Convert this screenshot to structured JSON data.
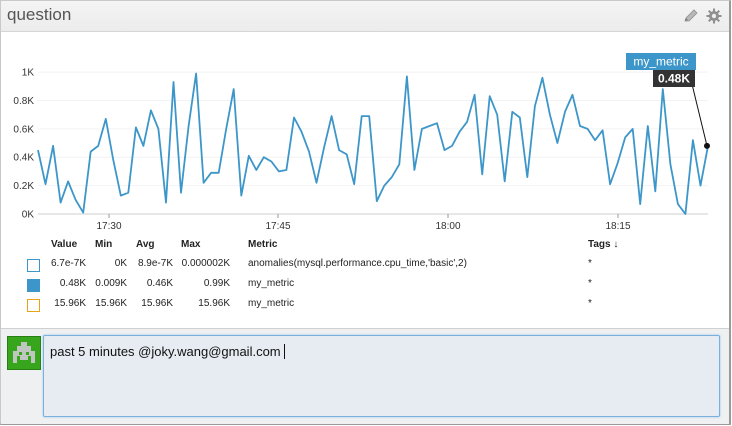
{
  "widget": {
    "title": "question",
    "edit_icon": "pencil-icon",
    "settings_icon": "gear-icon"
  },
  "chart_data": {
    "type": "line",
    "y_ticks": [
      "1K",
      "0.8K",
      "0.6K",
      "0.4K",
      "0.2K",
      "0K"
    ],
    "x_ticks": [
      "17:30",
      "17:45",
      "18:00",
      "18:15"
    ],
    "ylim": [
      0,
      1050
    ],
    "series": [
      {
        "name": "my_metric",
        "color": "#3d96c9",
        "values": [
          450,
          210,
          480,
          80,
          230,
          100,
          10,
          440,
          480,
          670,
          380,
          130,
          150,
          610,
          480,
          730,
          600,
          80,
          930,
          150,
          620,
          990,
          220,
          290,
          290,
          600,
          880,
          130,
          410,
          310,
          400,
          370,
          300,
          310,
          680,
          580,
          440,
          220,
          470,
          690,
          450,
          420,
          210,
          690,
          690,
          90,
          200,
          260,
          350,
          970,
          310,
          600,
          620,
          640,
          450,
          480,
          580,
          650,
          840,
          280,
          830,
          700,
          230,
          720,
          680,
          260,
          760,
          960,
          700,
          500,
          720,
          840,
          620,
          600,
          520,
          590,
          210,
          360,
          540,
          600,
          70,
          620,
          160,
          880,
          350,
          70,
          0,
          520,
          200,
          480
        ]
      }
    ],
    "tooltip": {
      "series": "my_metric",
      "value": "0.48K"
    },
    "legend": {
      "headers": {
        "value": "Value",
        "min": "Min",
        "avg": "Avg",
        "max": "Max",
        "metric": "Metric",
        "tags": "Tags ↓"
      },
      "rows": [
        {
          "swatch_style": "outline",
          "color": "#3d96c9",
          "value": "6.7e-7K",
          "min": "0K",
          "avg": "8.9e-7K",
          "max": "0.000002K",
          "metric": "anomalies(mysql.performance.cpu_time,'basic',2)",
          "tags": "*"
        },
        {
          "swatch_style": "filled",
          "color": "#3d96c9",
          "value": "0.48K",
          "min": "0.009K",
          "avg": "0.46K",
          "max": "0.99K",
          "metric": "my_metric",
          "tags": "*"
        },
        {
          "swatch_style": "outline",
          "color": "#e8a417",
          "value": "15.96K",
          "min": "15.96K",
          "avg": "15.96K",
          "max": "15.96K",
          "metric": "my_metric",
          "tags": "*"
        }
      ]
    }
  },
  "comment": {
    "text": "past 5 minutes @joky.wang@gmail.com"
  }
}
